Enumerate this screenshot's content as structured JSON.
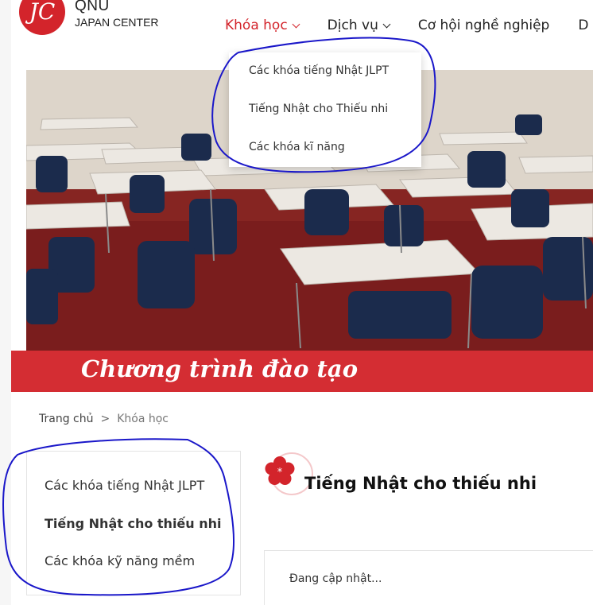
{
  "brand": {
    "logo_text": "JC",
    "name": "QNU",
    "subtitle": "JAPAN CENTER"
  },
  "nav": {
    "items": [
      {
        "label": "Khóa học",
        "active": true
      },
      {
        "label": "Dịch vụ"
      },
      {
        "label": "Cơ hội nghề nghiệp"
      },
      {
        "label": "D"
      }
    ],
    "dropdown": [
      "Các khóa tiếng Nhật JLPT",
      "Tiếng Nhật cho Thiếu nhi",
      "Các khóa kĩ năng"
    ]
  },
  "banner": {
    "title": "Chương trình đào tạo"
  },
  "breadcrumb": {
    "home": "Trang chủ",
    "separator": ">",
    "current": "Khóa học"
  },
  "sidebar": {
    "items": [
      "Các khóa tiếng Nhật JLPT",
      "Tiếng Nhật cho thiếu nhi",
      "Các khóa kỹ năng mềm"
    ]
  },
  "content": {
    "title": "Tiếng Nhật cho thiếu nhi",
    "body": "Đang cập nhật..."
  },
  "colors": {
    "accent": "#d3242b",
    "annotation": "#1a17c9"
  }
}
